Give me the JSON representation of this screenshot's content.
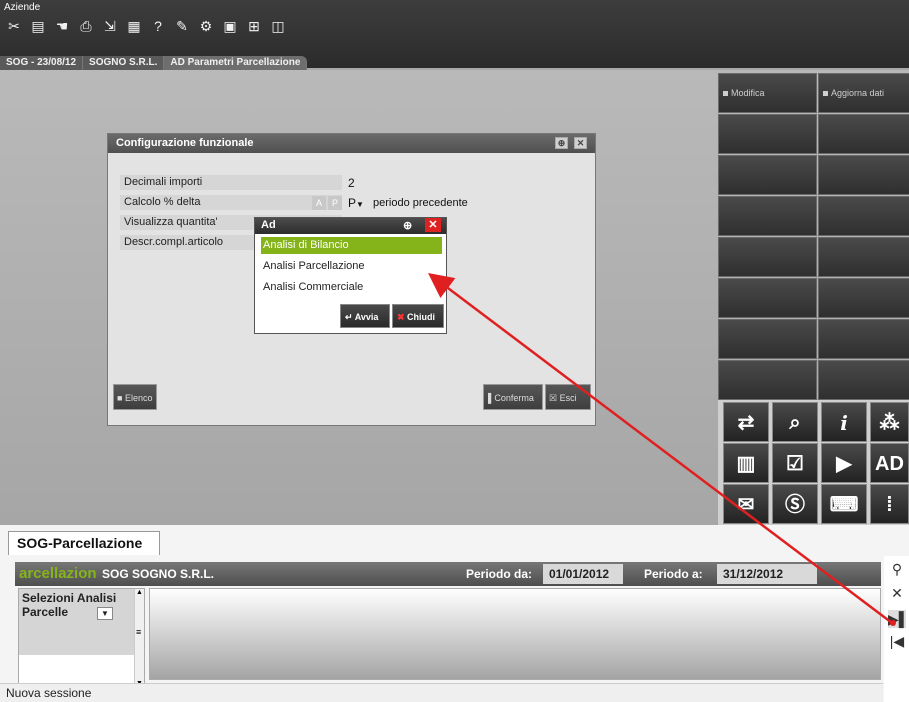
{
  "app": {
    "title": "Aziende"
  },
  "toolbar": {
    "icons": [
      "scissors-icon",
      "document-icon",
      "hand-icon",
      "printer-icon",
      "export-icon",
      "table-icon",
      "help-icon",
      "edit-icon",
      "settings-icon",
      "calculator-icon",
      "fullscreen-icon",
      "window-icon"
    ]
  },
  "breadcrumb": {
    "tabs": [
      "SOG - 23/08/12",
      "SOGNO S.R.L.",
      "AD Parametri Parcellazione"
    ]
  },
  "command_panel": {
    "modifica": "Modifica",
    "aggiorna": "Aggiorna dati"
  },
  "icon_grid": {
    "ad_label": "AD"
  },
  "dialog": {
    "title": "Configurazione funzionale",
    "fields": [
      {
        "label": "Decimali importi",
        "value": "2"
      },
      {
        "label": "Calcolo % delta",
        "value": "P",
        "extra": "periodo precedente"
      },
      {
        "label": "Visualizza quantita'",
        "value": ""
      },
      {
        "label": "Descr.compl.articolo",
        "value": ""
      }
    ],
    "btn_a": "A",
    "btn_p": "P",
    "elenco": "Elenco",
    "conferma": "Conferma",
    "esci": "Esci"
  },
  "popup": {
    "title": "Ad",
    "items": [
      "Analisi di Bilancio",
      "Analisi Parcellazione",
      "Analisi Commerciale"
    ],
    "selected_index": 0,
    "avvia": "Avvia",
    "chiudi": "Chiudi"
  },
  "bottom": {
    "tab": "SOG-Parcellazione",
    "session_label": "arcellazion",
    "company": "SOG SOGNO S.R.L.",
    "periodo_da_label": "Periodo da:",
    "periodo_da": "01/01/2012",
    "periodo_a_label": "Periodo a:",
    "periodo_a": "31/12/2012",
    "selezioni_header": "Selezioni Analisi",
    "selezioni_value": "Parcelle",
    "status": "Nuova sessione"
  },
  "colors": {
    "accent_green": "#84b41a",
    "arrow_red": "#e02020",
    "dark_bar": "#2b2b2b"
  }
}
